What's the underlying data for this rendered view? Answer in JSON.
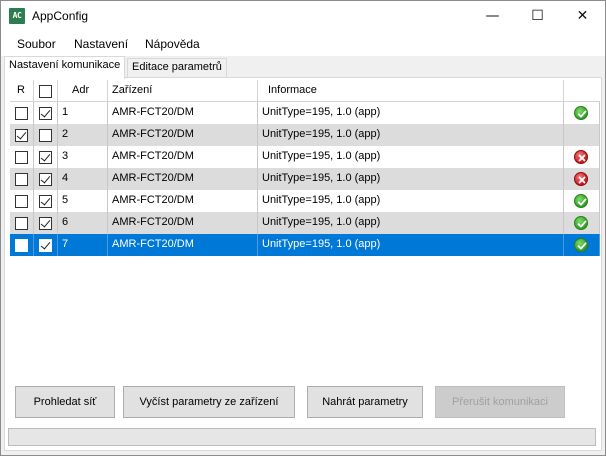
{
  "window": {
    "title": "AppConfig",
    "icon_text": "AC",
    "minimize_glyph": "—",
    "maximize_glyph": "☐",
    "close_glyph": "✕"
  },
  "menu": [
    {
      "label": "Soubor"
    },
    {
      "label": "Nastavení"
    },
    {
      "label": "Nápověda"
    }
  ],
  "tabs": [
    {
      "label": "Nastavení komunikace",
      "active": true
    },
    {
      "label": "Editace parametrů",
      "active": false
    }
  ],
  "grid": {
    "columns": {
      "r": "R",
      "adr": "Adr",
      "device": "Zařízení",
      "info": "Informace"
    },
    "rows": [
      {
        "r": false,
        "checked": true,
        "adr": "1",
        "device": "AMR-FCT20/DM",
        "info": "UnitType=195, 1.0 (app)",
        "status": "ok",
        "style": "normal"
      },
      {
        "r": true,
        "checked": false,
        "adr": "2",
        "device": "AMR-FCT20/DM",
        "info": "UnitType=195, 1.0 (app)",
        "status": "none",
        "style": "alt"
      },
      {
        "r": false,
        "checked": true,
        "adr": "3",
        "device": "AMR-FCT20/DM",
        "info": "UnitType=195, 1.0 (app)",
        "status": "error",
        "style": "normal"
      },
      {
        "r": false,
        "checked": true,
        "adr": "4",
        "device": "AMR-FCT20/DM",
        "info": "UnitType=195, 1.0 (app)",
        "status": "error",
        "style": "alt"
      },
      {
        "r": false,
        "checked": true,
        "adr": "5",
        "device": "AMR-FCT20/DM",
        "info": "UnitType=195, 1.0 (app)",
        "status": "ok",
        "style": "normal"
      },
      {
        "r": false,
        "checked": true,
        "adr": "6",
        "device": "AMR-FCT20/DM",
        "info": "UnitType=195, 1.0 (app)",
        "status": "ok",
        "style": "alt"
      },
      {
        "r": false,
        "checked": true,
        "adr": "7",
        "device": "AMR-FCT20/DM",
        "info": "UnitType=195, 1.0 (app)",
        "status": "ok",
        "style": "selected"
      }
    ]
  },
  "buttons": {
    "search": "Prohledat síť",
    "read_params": "Vyčíst parametry ze zařízení",
    "upload_params": "Nahrát parametry",
    "stop": "Přerušit komunikaci"
  },
  "colors": {
    "selection": "#0078d7",
    "alt_row": "#dcdcdc",
    "ok": "#2e9e23",
    "error": "#c9151a"
  }
}
